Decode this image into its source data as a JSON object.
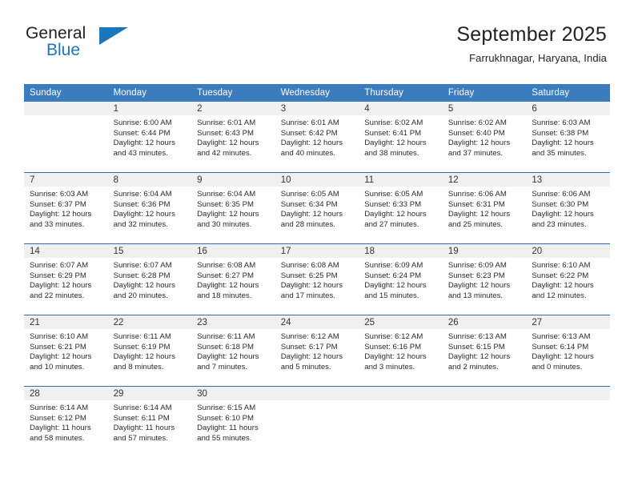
{
  "brand": {
    "name_top": "General",
    "name_bottom": "Blue",
    "accent_color": "#1b76bc"
  },
  "header": {
    "title": "September 2025",
    "subtitle": "Farrukhnagar, Haryana, India"
  },
  "theme": {
    "header_row_bg": "#3a7cbe",
    "row_divider": "#2f6fad",
    "daynum_bg": "#f0f0f0",
    "text": "#2b2b2b"
  },
  "weekday_headers": [
    "Sunday",
    "Monday",
    "Tuesday",
    "Wednesday",
    "Thursday",
    "Friday",
    "Saturday"
  ],
  "weeks": [
    [
      {
        "day": "",
        "sunrise": "",
        "sunset": "",
        "daylight_line1": "",
        "daylight_line2": ""
      },
      {
        "day": "1",
        "sunrise": "Sunrise: 6:00 AM",
        "sunset": "Sunset: 6:44 PM",
        "daylight_line1": "Daylight: 12 hours",
        "daylight_line2": "and 43 minutes."
      },
      {
        "day": "2",
        "sunrise": "Sunrise: 6:01 AM",
        "sunset": "Sunset: 6:43 PM",
        "daylight_line1": "Daylight: 12 hours",
        "daylight_line2": "and 42 minutes."
      },
      {
        "day": "3",
        "sunrise": "Sunrise: 6:01 AM",
        "sunset": "Sunset: 6:42 PM",
        "daylight_line1": "Daylight: 12 hours",
        "daylight_line2": "and 40 minutes."
      },
      {
        "day": "4",
        "sunrise": "Sunrise: 6:02 AM",
        "sunset": "Sunset: 6:41 PM",
        "daylight_line1": "Daylight: 12 hours",
        "daylight_line2": "and 38 minutes."
      },
      {
        "day": "5",
        "sunrise": "Sunrise: 6:02 AM",
        "sunset": "Sunset: 6:40 PM",
        "daylight_line1": "Daylight: 12 hours",
        "daylight_line2": "and 37 minutes."
      },
      {
        "day": "6",
        "sunrise": "Sunrise: 6:03 AM",
        "sunset": "Sunset: 6:38 PM",
        "daylight_line1": "Daylight: 12 hours",
        "daylight_line2": "and 35 minutes."
      }
    ],
    [
      {
        "day": "7",
        "sunrise": "Sunrise: 6:03 AM",
        "sunset": "Sunset: 6:37 PM",
        "daylight_line1": "Daylight: 12 hours",
        "daylight_line2": "and 33 minutes."
      },
      {
        "day": "8",
        "sunrise": "Sunrise: 6:04 AM",
        "sunset": "Sunset: 6:36 PM",
        "daylight_line1": "Daylight: 12 hours",
        "daylight_line2": "and 32 minutes."
      },
      {
        "day": "9",
        "sunrise": "Sunrise: 6:04 AM",
        "sunset": "Sunset: 6:35 PM",
        "daylight_line1": "Daylight: 12 hours",
        "daylight_line2": "and 30 minutes."
      },
      {
        "day": "10",
        "sunrise": "Sunrise: 6:05 AM",
        "sunset": "Sunset: 6:34 PM",
        "daylight_line1": "Daylight: 12 hours",
        "daylight_line2": "and 28 minutes."
      },
      {
        "day": "11",
        "sunrise": "Sunrise: 6:05 AM",
        "sunset": "Sunset: 6:33 PM",
        "daylight_line1": "Daylight: 12 hours",
        "daylight_line2": "and 27 minutes."
      },
      {
        "day": "12",
        "sunrise": "Sunrise: 6:06 AM",
        "sunset": "Sunset: 6:31 PM",
        "daylight_line1": "Daylight: 12 hours",
        "daylight_line2": "and 25 minutes."
      },
      {
        "day": "13",
        "sunrise": "Sunrise: 6:06 AM",
        "sunset": "Sunset: 6:30 PM",
        "daylight_line1": "Daylight: 12 hours",
        "daylight_line2": "and 23 minutes."
      }
    ],
    [
      {
        "day": "14",
        "sunrise": "Sunrise: 6:07 AM",
        "sunset": "Sunset: 6:29 PM",
        "daylight_line1": "Daylight: 12 hours",
        "daylight_line2": "and 22 minutes."
      },
      {
        "day": "15",
        "sunrise": "Sunrise: 6:07 AM",
        "sunset": "Sunset: 6:28 PM",
        "daylight_line1": "Daylight: 12 hours",
        "daylight_line2": "and 20 minutes."
      },
      {
        "day": "16",
        "sunrise": "Sunrise: 6:08 AM",
        "sunset": "Sunset: 6:27 PM",
        "daylight_line1": "Daylight: 12 hours",
        "daylight_line2": "and 18 minutes."
      },
      {
        "day": "17",
        "sunrise": "Sunrise: 6:08 AM",
        "sunset": "Sunset: 6:25 PM",
        "daylight_line1": "Daylight: 12 hours",
        "daylight_line2": "and 17 minutes."
      },
      {
        "day": "18",
        "sunrise": "Sunrise: 6:09 AM",
        "sunset": "Sunset: 6:24 PM",
        "daylight_line1": "Daylight: 12 hours",
        "daylight_line2": "and 15 minutes."
      },
      {
        "day": "19",
        "sunrise": "Sunrise: 6:09 AM",
        "sunset": "Sunset: 6:23 PM",
        "daylight_line1": "Daylight: 12 hours",
        "daylight_line2": "and 13 minutes."
      },
      {
        "day": "20",
        "sunrise": "Sunrise: 6:10 AM",
        "sunset": "Sunset: 6:22 PM",
        "daylight_line1": "Daylight: 12 hours",
        "daylight_line2": "and 12 minutes."
      }
    ],
    [
      {
        "day": "21",
        "sunrise": "Sunrise: 6:10 AM",
        "sunset": "Sunset: 6:21 PM",
        "daylight_line1": "Daylight: 12 hours",
        "daylight_line2": "and 10 minutes."
      },
      {
        "day": "22",
        "sunrise": "Sunrise: 6:11 AM",
        "sunset": "Sunset: 6:19 PM",
        "daylight_line1": "Daylight: 12 hours",
        "daylight_line2": "and 8 minutes."
      },
      {
        "day": "23",
        "sunrise": "Sunrise: 6:11 AM",
        "sunset": "Sunset: 6:18 PM",
        "daylight_line1": "Daylight: 12 hours",
        "daylight_line2": "and 7 minutes."
      },
      {
        "day": "24",
        "sunrise": "Sunrise: 6:12 AM",
        "sunset": "Sunset: 6:17 PM",
        "daylight_line1": "Daylight: 12 hours",
        "daylight_line2": "and 5 minutes."
      },
      {
        "day": "25",
        "sunrise": "Sunrise: 6:12 AM",
        "sunset": "Sunset: 6:16 PM",
        "daylight_line1": "Daylight: 12 hours",
        "daylight_line2": "and 3 minutes."
      },
      {
        "day": "26",
        "sunrise": "Sunrise: 6:13 AM",
        "sunset": "Sunset: 6:15 PM",
        "daylight_line1": "Daylight: 12 hours",
        "daylight_line2": "and 2 minutes."
      },
      {
        "day": "27",
        "sunrise": "Sunrise: 6:13 AM",
        "sunset": "Sunset: 6:14 PM",
        "daylight_line1": "Daylight: 12 hours",
        "daylight_line2": "and 0 minutes."
      }
    ],
    [
      {
        "day": "28",
        "sunrise": "Sunrise: 6:14 AM",
        "sunset": "Sunset: 6:12 PM",
        "daylight_line1": "Daylight: 11 hours",
        "daylight_line2": "and 58 minutes."
      },
      {
        "day": "29",
        "sunrise": "Sunrise: 6:14 AM",
        "sunset": "Sunset: 6:11 PM",
        "daylight_line1": "Daylight: 11 hours",
        "daylight_line2": "and 57 minutes."
      },
      {
        "day": "30",
        "sunrise": "Sunrise: 6:15 AM",
        "sunset": "Sunset: 6:10 PM",
        "daylight_line1": "Daylight: 11 hours",
        "daylight_line2": "and 55 minutes."
      },
      {
        "day": "",
        "sunrise": "",
        "sunset": "",
        "daylight_line1": "",
        "daylight_line2": ""
      },
      {
        "day": "",
        "sunrise": "",
        "sunset": "",
        "daylight_line1": "",
        "daylight_line2": ""
      },
      {
        "day": "",
        "sunrise": "",
        "sunset": "",
        "daylight_line1": "",
        "daylight_line2": ""
      },
      {
        "day": "",
        "sunrise": "",
        "sunset": "",
        "daylight_line1": "",
        "daylight_line2": ""
      }
    ]
  ]
}
